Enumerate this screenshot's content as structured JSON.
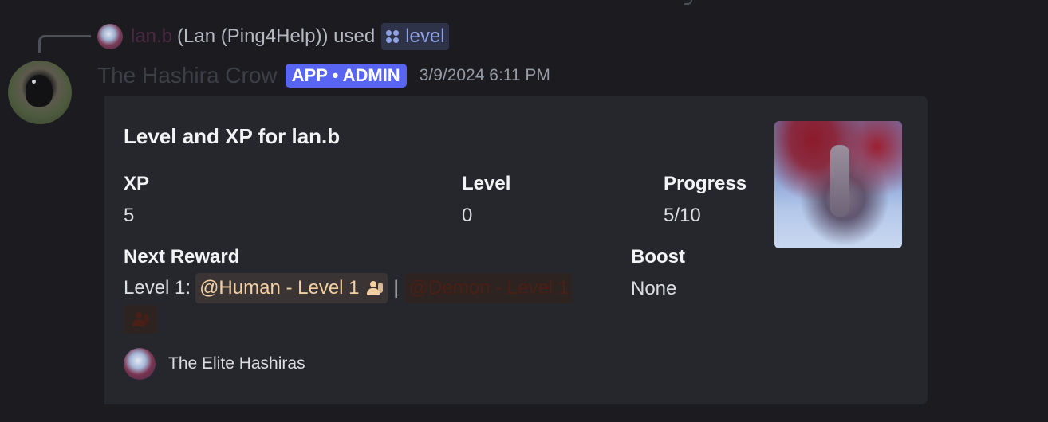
{
  "reply": {
    "username": "lan.b",
    "text": "(Lan (Ping4Help)) used",
    "command": "level"
  },
  "message": {
    "author": "The Hashira Crow",
    "badge": "APP • ADMIN",
    "timestamp": "3/9/2024 6:11 PM"
  },
  "embed": {
    "title": "Level and XP for lan.b",
    "fields": {
      "xp": {
        "name": "XP",
        "value": "5"
      },
      "level": {
        "name": "Level",
        "value": "0"
      },
      "progress": {
        "name": "Progress",
        "value": "5/10"
      },
      "next_reward": {
        "name": "Next Reward",
        "prefix": "Level 1:"
      },
      "boost": {
        "name": "Boost",
        "value": "None"
      }
    },
    "roles": [
      {
        "label": "@Human - Level 1",
        "icon": "people-icon"
      },
      {
        "label": "@Demon - Level 1",
        "icon": "people-icon"
      }
    ],
    "separator": "|",
    "footer": "The Elite Hashiras"
  },
  "colors": {
    "background": "#1b1b20",
    "embed_bg": "#26262d",
    "badge": "#5865f2",
    "command_link": "#8ea1e1",
    "human_role": "#f4cfa3",
    "demon_role": "#4a1f16"
  },
  "icons": [
    "reply-spine",
    "command-icon",
    "people-icon",
    "avatar",
    "thumbnail"
  ]
}
